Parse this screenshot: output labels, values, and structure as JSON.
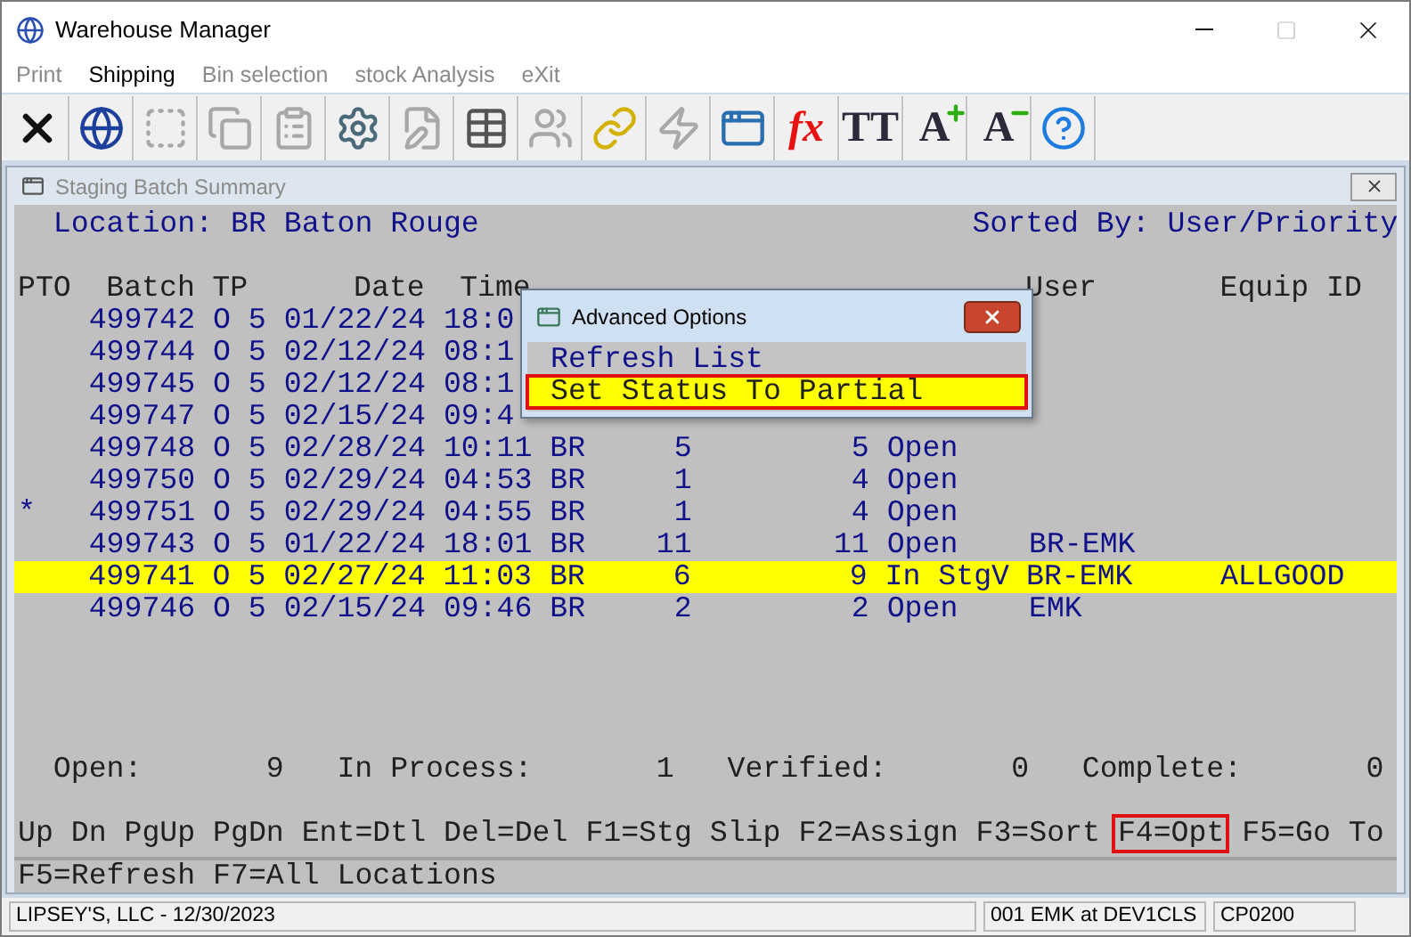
{
  "window": {
    "title": "Warehouse Manager"
  },
  "menu": [
    {
      "label": "Print",
      "selected": false
    },
    {
      "label": "Shipping",
      "selected": true
    },
    {
      "label": "Bin selection",
      "selected": false
    },
    {
      "label": "stock Analysis",
      "selected": false
    },
    {
      "label": "eXit",
      "selected": false
    }
  ],
  "toolbar": [
    {
      "kind": "icon",
      "disabled": false
    },
    {
      "kind": "icon",
      "disabled": false
    },
    {
      "kind": "icon",
      "disabled": true
    },
    {
      "kind": "icon",
      "disabled": true
    },
    {
      "kind": "icon",
      "disabled": true
    },
    {
      "kind": "icon",
      "disabled": false
    },
    {
      "kind": "icon",
      "disabled": true
    },
    {
      "kind": "icon",
      "disabled": false
    },
    {
      "kind": "icon",
      "disabled": true
    },
    {
      "kind": "icon",
      "disabled": false
    },
    {
      "kind": "icon",
      "disabled": true
    },
    {
      "kind": "icon",
      "disabled": false
    },
    {
      "kind": "glyph",
      "text": "fx",
      "color": "#e81010",
      "disabled": false
    },
    {
      "kind": "glyph",
      "text": "TT",
      "color": "#2a2a3a",
      "disabled": false
    },
    {
      "kind": "glyph_plus",
      "text": "A",
      "color": "#2a2a3a",
      "disabled": false
    },
    {
      "kind": "glyph_minus",
      "text": "A",
      "color": "#2a2a3a",
      "disabled": false
    },
    {
      "kind": "icon",
      "disabled": false
    }
  ],
  "child_window": {
    "title": "Staging Batch Summary"
  },
  "location": "Location: BR Baton Rouge",
  "sorted_by": "Sorted By: User/Priority",
  "columns": [
    "PTO",
    "Batch",
    "TP",
    "Date",
    "Time"
  ],
  "columns_right": [
    "User",
    "Equip ID"
  ],
  "rows": [
    {
      "batch": "499742",
      "tp": "O 5",
      "date": "01/22/24",
      "time": "18:0",
      "selected": false
    },
    {
      "batch": "499744",
      "tp": "O 5",
      "date": "02/12/24",
      "time": "08:1",
      "selected": false
    },
    {
      "batch": "499745",
      "tp": "O 5",
      "date": "02/12/24",
      "time": "08:1",
      "selected": false
    },
    {
      "batch": "499747",
      "tp": "O 5",
      "date": "02/15/24",
      "time": "09:4",
      "selected": false
    },
    {
      "batch": "499748",
      "tp": "O 5",
      "date": "02/28/24",
      "time": "10:11",
      "wh": "BR",
      "orders": "5",
      "qty": "5",
      "status": "Open",
      "selected": false
    },
    {
      "batch": "499750",
      "tp": "O 5",
      "date": "02/29/24",
      "time": "04:53",
      "wh": "BR",
      "orders": "1",
      "qty": "4",
      "status": "Open",
      "selected": false
    },
    {
      "pto": "*",
      "batch": "499751",
      "tp": "O 5",
      "date": "02/29/24",
      "time": "04:55",
      "wh": "BR",
      "orders": "1",
      "qty": "4",
      "status": "Open",
      "selected": false
    },
    {
      "batch": "499743",
      "tp": "O 5",
      "date": "01/22/24",
      "time": "18:01",
      "wh": "BR",
      "orders": "11",
      "qty": "11",
      "status": "Open",
      "user": "BR-EMK",
      "selected": false
    },
    {
      "batch": "499741",
      "tp": "O 5",
      "date": "02/27/24",
      "time": "11:03",
      "wh": "BR",
      "orders": "6",
      "qty": "9",
      "status": "In StgV",
      "user": "BR-EMK",
      "equip": "ALLGOOD",
      "selected": true
    },
    {
      "batch": "499746",
      "tp": "O 5",
      "date": "02/15/24",
      "time": "09:46",
      "wh": "BR",
      "orders": "2",
      "qty": "2",
      "status": "Open",
      "user": "EMK",
      "selected": false
    }
  ],
  "totals": [
    {
      "label": "Open:",
      "value": "9"
    },
    {
      "label": "In Process:",
      "value": "1"
    },
    {
      "label": "Verified:",
      "value": "0"
    },
    {
      "label": "Complete:",
      "value": "0"
    }
  ],
  "keys": [
    {
      "label": "Up",
      "highlighted": false
    },
    {
      "label": "Dn",
      "highlighted": false
    },
    {
      "label": "PgUp",
      "highlighted": false
    },
    {
      "label": "PgDn",
      "highlighted": false
    },
    {
      "label": "Ent=Dtl",
      "highlighted": false
    },
    {
      "label": "Del=Del",
      "highlighted": false
    },
    {
      "label": "F1=Stg Slip",
      "highlighted": false
    },
    {
      "label": "F2=Assign",
      "highlighted": false
    },
    {
      "label": "F3=Sort",
      "highlighted": false
    },
    {
      "label": "F4=Opt",
      "highlighted": true
    },
    {
      "label": "F5=Go To",
      "highlighted": false
    }
  ],
  "keys_line_2": [
    "F5=Refresh",
    "F7=All Locations"
  ],
  "dialog": {
    "title": "Advanced Options",
    "items": [
      {
        "label": "Refresh List",
        "selected": false
      },
      {
        "label": "Set Status To Partial",
        "selected": true
      }
    ]
  },
  "status_bar": {
    "company": "LIPSEY'S, LLC - 12/30/2023",
    "user": "001 EMK at DEV1CLS",
    "program": "CP0200"
  }
}
